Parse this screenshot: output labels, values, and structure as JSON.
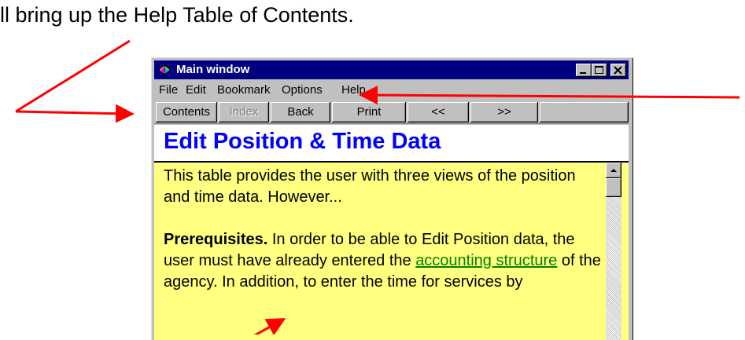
{
  "caption": "ill bring up the Help Table of Contents.",
  "window": {
    "title": "Main window",
    "menu": [
      "File",
      "Edit",
      "Bookmark",
      "Options",
      "Help"
    ],
    "toolbar": {
      "contents": "Contents",
      "index": "Index",
      "back": "Back",
      "print": "Print",
      "prev": "<<",
      "next": ">>"
    },
    "topic_title": "Edit Position & Time Data",
    "body": {
      "intro": "This table provides the user with three views of the position and time data. However...",
      "prereq_label": "Prerequisites.",
      "prereq_text_1": " In order to be able to Edit Position data, the user must have already entered the ",
      "link_text": "accounting structure",
      "prereq_text_2": " of the agency. In addition, to enter the time for services by"
    }
  },
  "colors": {
    "title_bar": "#000080",
    "content_bg": "#ffff80",
    "topic_title": "#0000ff",
    "link": "#008000",
    "annotation_arrows": "#ff0000"
  },
  "icons": {
    "app": "help-book-icon",
    "minimize": "minimize-icon",
    "maximize": "maximize-icon",
    "close": "close-icon"
  }
}
